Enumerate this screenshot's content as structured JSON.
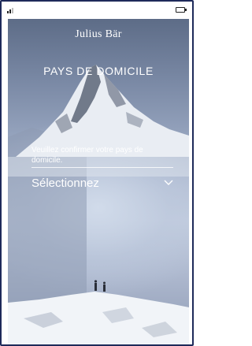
{
  "app": {
    "brand": "Julius Bär",
    "title": "PAYS DE DOMICILE"
  },
  "form": {
    "prompt": "Veuillez confirmer votre pays de domicile.",
    "select_label": "Sélectionnez"
  },
  "icons": {
    "signal": "signal-icon",
    "battery": "battery-icon",
    "dropdown": "chevron-down-icon"
  },
  "colors": {
    "frame": "#1e2a5a",
    "text": "#ffffff"
  }
}
